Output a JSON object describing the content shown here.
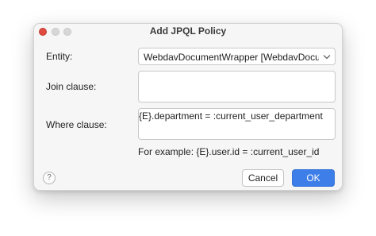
{
  "dialog": {
    "title": "Add JPQL Policy",
    "entity_label": "Entity:",
    "entity_value": "WebdavDocumentWrapper [WebdavDocumentWrapper]",
    "join_label": "Join clause:",
    "join_value": "",
    "where_label": "Where clause:",
    "where_value": "{E}.department = :current_user_department",
    "example_text": "For example: {E}.user.id = :current_user_id",
    "help_glyph": "?",
    "cancel_label": "Cancel",
    "ok_label": "OK"
  },
  "colors": {
    "primary_button": "#3d7ee8",
    "close_light": "#df4b3f",
    "inactive_light": "#d7d7d7"
  },
  "icons": {
    "entity_dropdown": "chevron-down-icon",
    "help": "help-icon"
  }
}
